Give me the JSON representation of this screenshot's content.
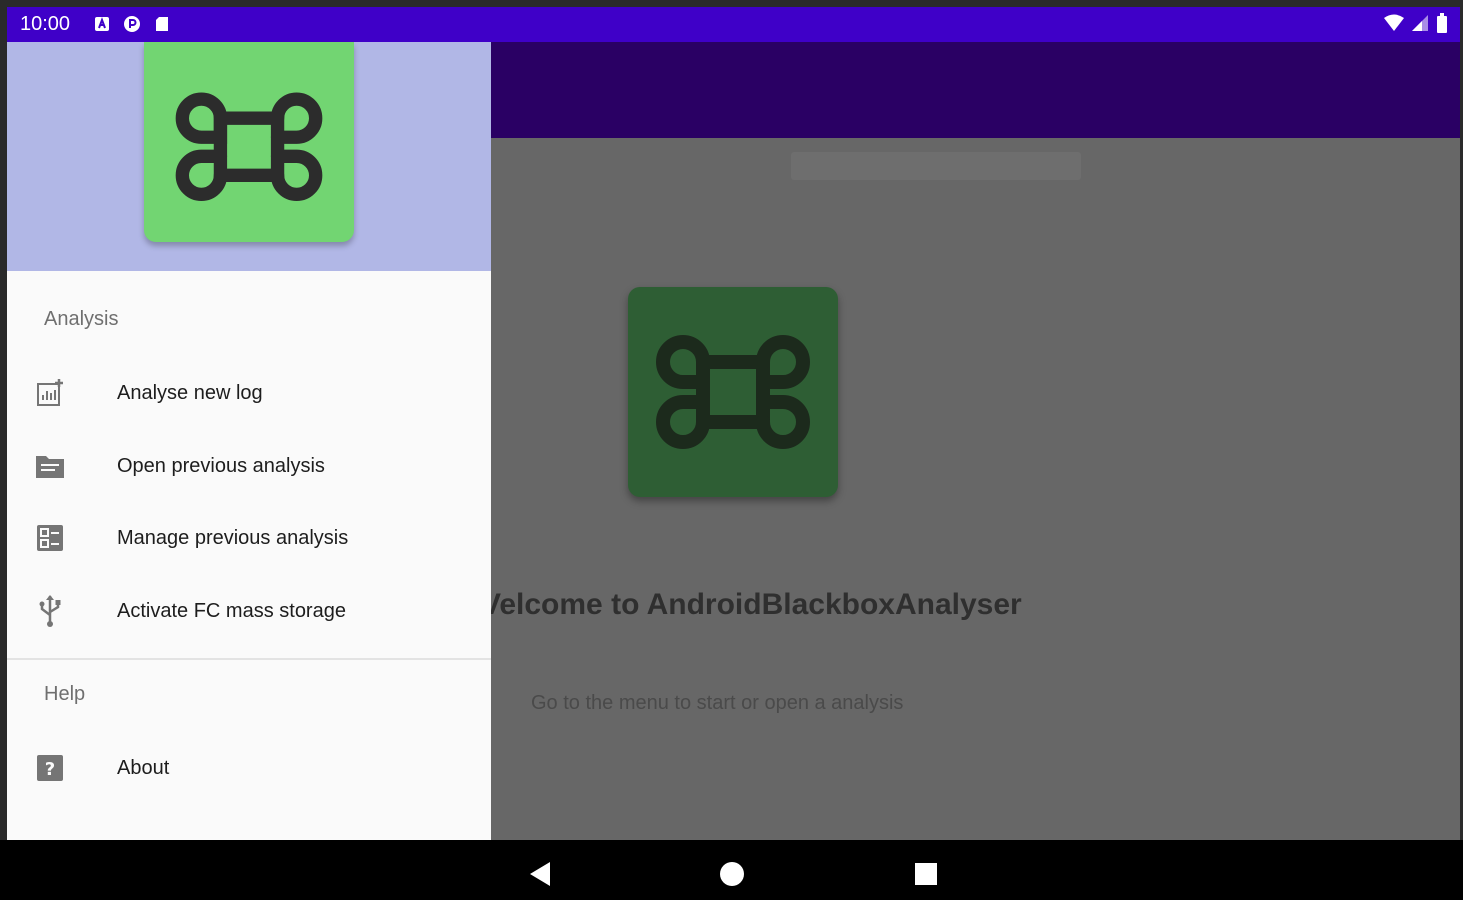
{
  "status": {
    "time": "10:00"
  },
  "drawer": {
    "sections": [
      {
        "title": "Analysis"
      },
      {
        "title": "Help"
      }
    ],
    "items": [
      {
        "label": "Analyse new log"
      },
      {
        "label": "Open previous analysis"
      },
      {
        "label": "Manage previous analysis"
      },
      {
        "label": "Activate FC mass storage"
      },
      {
        "label": "About"
      }
    ]
  },
  "main": {
    "welcome": "Velcome to AndroidBlackboxAnalyser",
    "subtitle": "Go to the menu to start or open a analysis"
  },
  "colors": {
    "status_bar": "#3f00c8",
    "app_bar": "#2a0064",
    "drawer_header": "#b1b7e6",
    "logo_green": "#72d572",
    "logo_dark_green": "#2e5e34"
  },
  "icons": {
    "logo": "command-key-icon",
    "analyse": "chart-add-icon",
    "open": "folder-icon",
    "manage": "checklist-icon",
    "usb": "usb-icon",
    "about": "help-icon"
  }
}
